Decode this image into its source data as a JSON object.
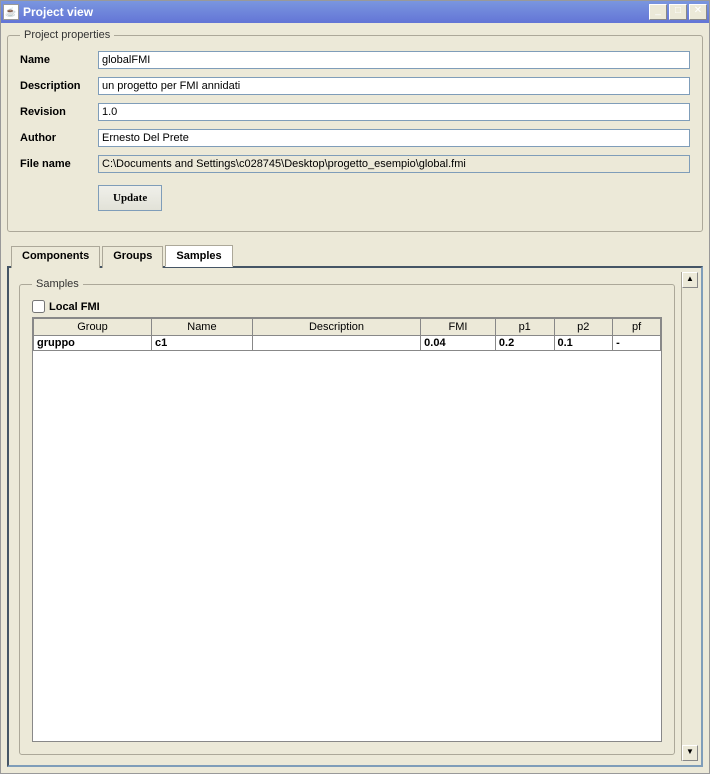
{
  "window": {
    "title": "Project view",
    "icon_label": "☕"
  },
  "properties": {
    "legend": "Project properties",
    "labels": {
      "name": "Name",
      "description": "Description",
      "revision": "Revision",
      "author": "Author",
      "filename": "File name"
    },
    "values": {
      "name": "globalFMI",
      "description": "un progetto per FMI annidati",
      "revision": "1.0",
      "author": "Ernesto Del Prete",
      "filename": "C:\\Documents and Settings\\c028745\\Desktop\\progetto_esempio\\global.fmi"
    },
    "update_button": "Update"
  },
  "tabs": {
    "components": "Components",
    "groups": "Groups",
    "samples": "Samples",
    "active": "samples"
  },
  "samples_panel": {
    "legend": "Samples",
    "local_fmi_label": "Local FMI",
    "local_fmi_checked": false,
    "columns": [
      "Group",
      "Name",
      "Description",
      "FMI",
      "p1",
      "p2",
      "pf"
    ],
    "rows": [
      {
        "cells": [
          "gruppo",
          "c1",
          "",
          "0.04",
          "0.2",
          "0.1",
          "-"
        ]
      }
    ]
  }
}
